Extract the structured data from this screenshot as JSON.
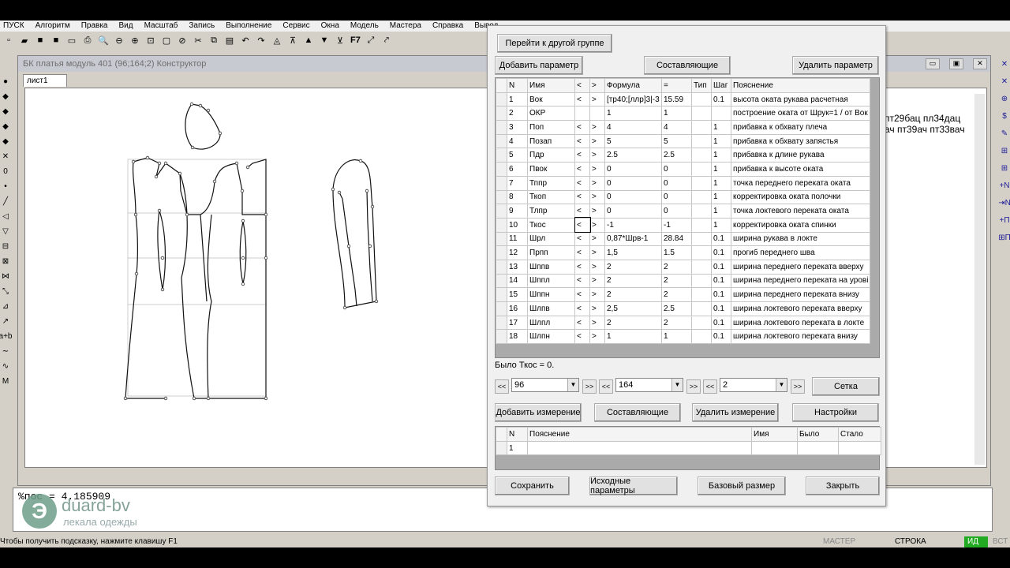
{
  "menu": [
    "ПУСК",
    "Алгоритм",
    "Правка",
    "Вид",
    "Масштаб",
    "Запись",
    "Выполнение",
    "Сервис",
    "Окна",
    "Модель",
    "Мастера",
    "Справка",
    "Вывод"
  ],
  "toolbar": {
    "f7_label": "F7"
  },
  "left_tools": [
    "●",
    "◆",
    "◆",
    "◆",
    "◆",
    "✕",
    "0",
    "•",
    "╱",
    "◁",
    "▽",
    "⊟",
    "⊠",
    "⋈",
    "⤡",
    "⊿",
    "↗",
    "a+b",
    "∼",
    "∿",
    "M"
  ],
  "right_tools": [
    "✕",
    "✕",
    "⊕",
    "$",
    "✎",
    "⊞",
    "⊞",
    "+N",
    "⇥N",
    "+П",
    "⊞П"
  ],
  "document": {
    "title": "БК платья модуль 401 (96;164;2) Конструктор",
    "tab": "лист1",
    "right_text": [
      "пт29бац пл34дац",
      "ач пт39ач пт33вач"
    ]
  },
  "console": {
    "text": "%пос = 4.185909"
  },
  "logo": {
    "brand": "duard-bv",
    "tagline": "лекала одежды"
  },
  "status": {
    "hint": "Чтобы получить подсказку, нажмите клавишу F1",
    "master": "МАСТЕР",
    "line": "СТРОКА",
    "id": "ИД",
    "vst": "ВСТ"
  },
  "dialog": {
    "goto_group": "Перейти к другой группе",
    "add_param": "Добавить параметр",
    "components": "Составляющие",
    "delete_param": "Удалить параметр",
    "param_headers": [
      "N",
      "Имя",
      "<",
      ">",
      "Формула",
      "=",
      "Тип",
      "Шаг",
      "Пояснение"
    ],
    "params": [
      [
        "1",
        "Вок",
        "<",
        ">",
        "[тр40;[ллр]3|-3",
        "15.59",
        "",
        "0.1",
        "высота оката рукава расчетная"
      ],
      [
        "2",
        "ОКР",
        "",
        "",
        "1",
        "1",
        "",
        "",
        "построение оката от Шрук=1 / от Вок"
      ],
      [
        "3",
        "Поп",
        "<",
        ">",
        "4",
        "4",
        "",
        "1",
        "прибавка к обхвату плеча"
      ],
      [
        "4",
        "Позап",
        "<",
        ">",
        "5",
        "5",
        "",
        "1",
        "прибавка к обхвату запястья"
      ],
      [
        "5",
        "Пдр",
        "<",
        ">",
        "2.5",
        "2.5",
        "",
        "1",
        "прибавка к длине рукава"
      ],
      [
        "6",
        "Пвок",
        "<",
        ">",
        "0",
        "0",
        "",
        "1",
        "прибавка к высоте оката"
      ],
      [
        "7",
        "Тппр",
        "<",
        ">",
        "0",
        "0",
        "",
        "1",
        "точка переднего переката оката"
      ],
      [
        "8",
        "Ткоп",
        "<",
        ">",
        "0",
        "0",
        "",
        "1",
        "корректировка оката полочки"
      ],
      [
        "9",
        "Тлпр",
        "<",
        ">",
        "0",
        "0",
        "",
        "1",
        "точка локтевого переката оката"
      ],
      [
        "10",
        "Ткос",
        "<",
        ">",
        "-1",
        "-1",
        "",
        "1",
        "корректировка оката спинки"
      ],
      [
        "11",
        "Шрл",
        "<",
        ">",
        "0,87*Шрв-1",
        "28.84",
        "",
        "0.1",
        "ширина рукава в локте"
      ],
      [
        "12",
        "Прпп",
        "<",
        ">",
        "1,5",
        "1.5",
        "",
        "0.1",
        "прогиб переднего шва"
      ],
      [
        "13",
        "Шппв",
        "<",
        ">",
        "2",
        "2",
        "",
        "0.1",
        "ширина переднего переката вверху"
      ],
      [
        "14",
        "Шппл",
        "<",
        ">",
        "2",
        "2",
        "",
        "0.1",
        "ширина переднего переката на урові"
      ],
      [
        "15",
        "Шппн",
        "<",
        ">",
        "2",
        "2",
        "",
        "0.1",
        "ширина переднего переката внизу"
      ],
      [
        "16",
        "Шлпв",
        "<",
        ">",
        "2,5",
        "2.5",
        "",
        "0.1",
        "ширина локтевого переката вверху"
      ],
      [
        "17",
        "Шлпл",
        "<",
        ">",
        "2",
        "2",
        "",
        "0.1",
        "ширина локтевого переката в локте"
      ],
      [
        "18",
        "Шлпн",
        "<",
        ">",
        "1",
        "1",
        "",
        "0.1",
        "ширина локтевого переката внизу"
      ]
    ],
    "info": "Было Ткос = 0.",
    "nav": {
      "prev": "<<",
      "next": ">>",
      "size1": "96",
      "size2": "164",
      "size3": "2"
    },
    "grid_btn": "Сетка",
    "add_measure": "Добавить измерение",
    "components2": "Составляющие",
    "delete_measure": "Удалить измерение",
    "settings": "Настройки",
    "meas_headers": [
      "N",
      "Пояснение",
      "Имя",
      "Было",
      "Стало"
    ],
    "meas_rows": [
      [
        "1",
        "",
        "",
        "",
        ""
      ]
    ],
    "save": "Сохранить",
    "source_params": "Исходные параметры",
    "base_size": "Базовый размер",
    "close": "Закрыть"
  }
}
